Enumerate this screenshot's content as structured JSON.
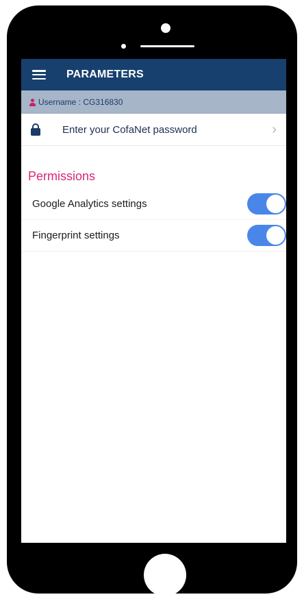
{
  "header": {
    "title": "PARAMETERS",
    "menu_icon": "hamburger-menu-icon"
  },
  "user": {
    "label": "Username : CG316830",
    "icon": "user-icon"
  },
  "password_row": {
    "label": "Enter your CofaNet password",
    "icon": "lock-icon",
    "trailing_icon": "chevron-right-icon"
  },
  "permissions": {
    "title": "Permissions",
    "items": [
      {
        "label": "Google Analytics settings",
        "enabled": true
      },
      {
        "label": "Fingerprint settings",
        "enabled": true
      }
    ]
  },
  "colors": {
    "header": "#17406e",
    "userbar": "#a6b5c8",
    "accent": "#d6287a",
    "toggle_on": "#4a86e8"
  }
}
